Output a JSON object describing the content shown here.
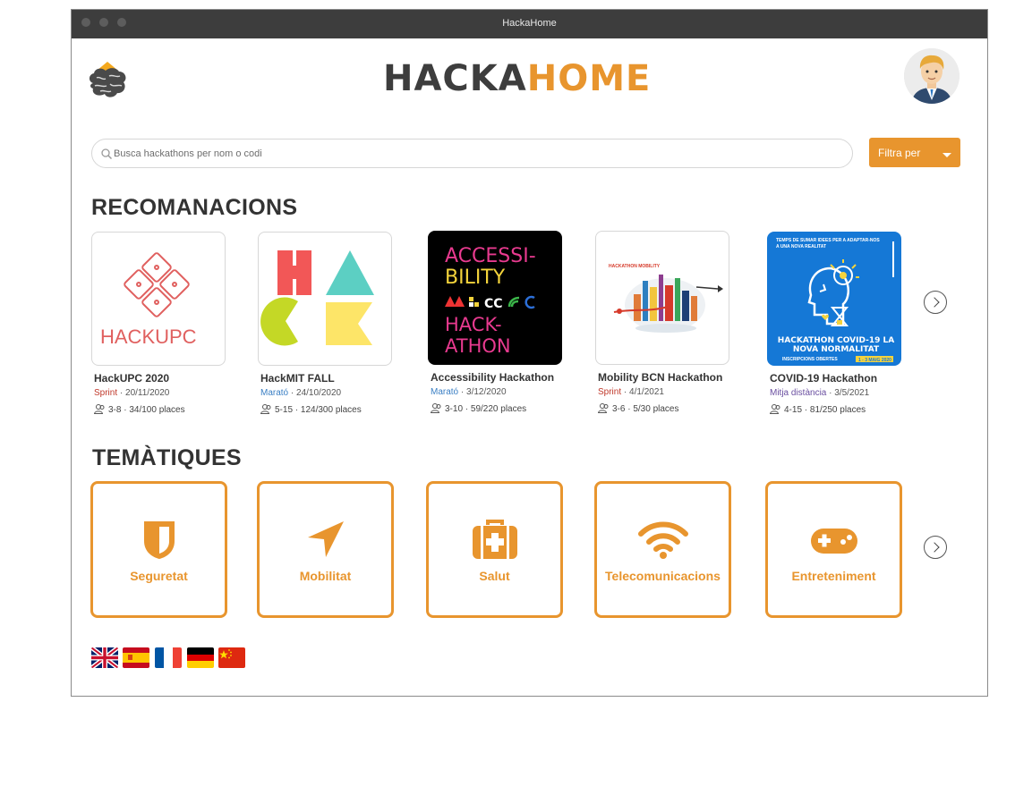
{
  "window": {
    "title": "HackaHome"
  },
  "brand": {
    "part1": "HACKA",
    "part2": "HOME"
  },
  "search": {
    "placeholder": "Busca hackathons per nom o codi"
  },
  "filter": {
    "label": "Filtra per"
  },
  "sections": {
    "recommendations": "RECOMANACIONS",
    "themes": "TEMÀTIQUES"
  },
  "cards": [
    {
      "name": "HackUPC 2020",
      "type": "Sprint",
      "date": " · 20/11/2020",
      "places": "3-8 · 34/100 places"
    },
    {
      "name": "HackMIT FALL",
      "type": "Marató",
      "date": " · 24/10/2020",
      "places": "5-15 · 124/300 places"
    },
    {
      "name": "Accessibility Hackathon",
      "type": "Marató",
      "date": " · 3/12/2020",
      "places": "3-10 · 59/220 places"
    },
    {
      "name": "Mobility BCN Hackathon",
      "type": "Sprint",
      "date": " · 4/1/2021",
      "places": "3-6 · 5/30 places"
    },
    {
      "name": "COVID-19 Hackathon",
      "type": "Mitja distància",
      "date": " · 3/5/2021",
      "places": "4-15 · 81/250 places"
    }
  ],
  "thumbs": {
    "hackupc": "HACKUPC",
    "access_lines": [
      "ACCESSI-",
      "BILITY",
      "HACK-",
      "ATHON"
    ],
    "mobility_small": "HACKATHON MOBILITY",
    "covid_top": "TEMPS DE SUMAR IDEES PER A ADAPTAR-NOS A UNA NOVA REALITAT",
    "covid_title": "HACKATHON COVID-19 LA NOVA NORMALITAT",
    "covid_bottom": "INSCRIPCIONS OBERTES",
    "covid_date": "1 - 3 MAIG 2020"
  },
  "themes": [
    {
      "label": "Seguretat",
      "icon": "shield-icon"
    },
    {
      "label": "Mobilitat",
      "icon": "location-arrow-icon"
    },
    {
      "label": "Salut",
      "icon": "first-aid-kit-icon"
    },
    {
      "label": "Telecomunicacions",
      "icon": "wifi-icon"
    },
    {
      "label": "Entreteniment",
      "icon": "gamepad-icon"
    }
  ],
  "languages": [
    "english-flag",
    "spanish-flag",
    "french-flag",
    "german-flag",
    "chinese-flag"
  ],
  "colors": {
    "accent": "#e8952e",
    "titlebar": "#3d3d3d",
    "sprint": "#c0392b",
    "marato": "#3a7fc4",
    "mitja": "#6a4fa0"
  }
}
